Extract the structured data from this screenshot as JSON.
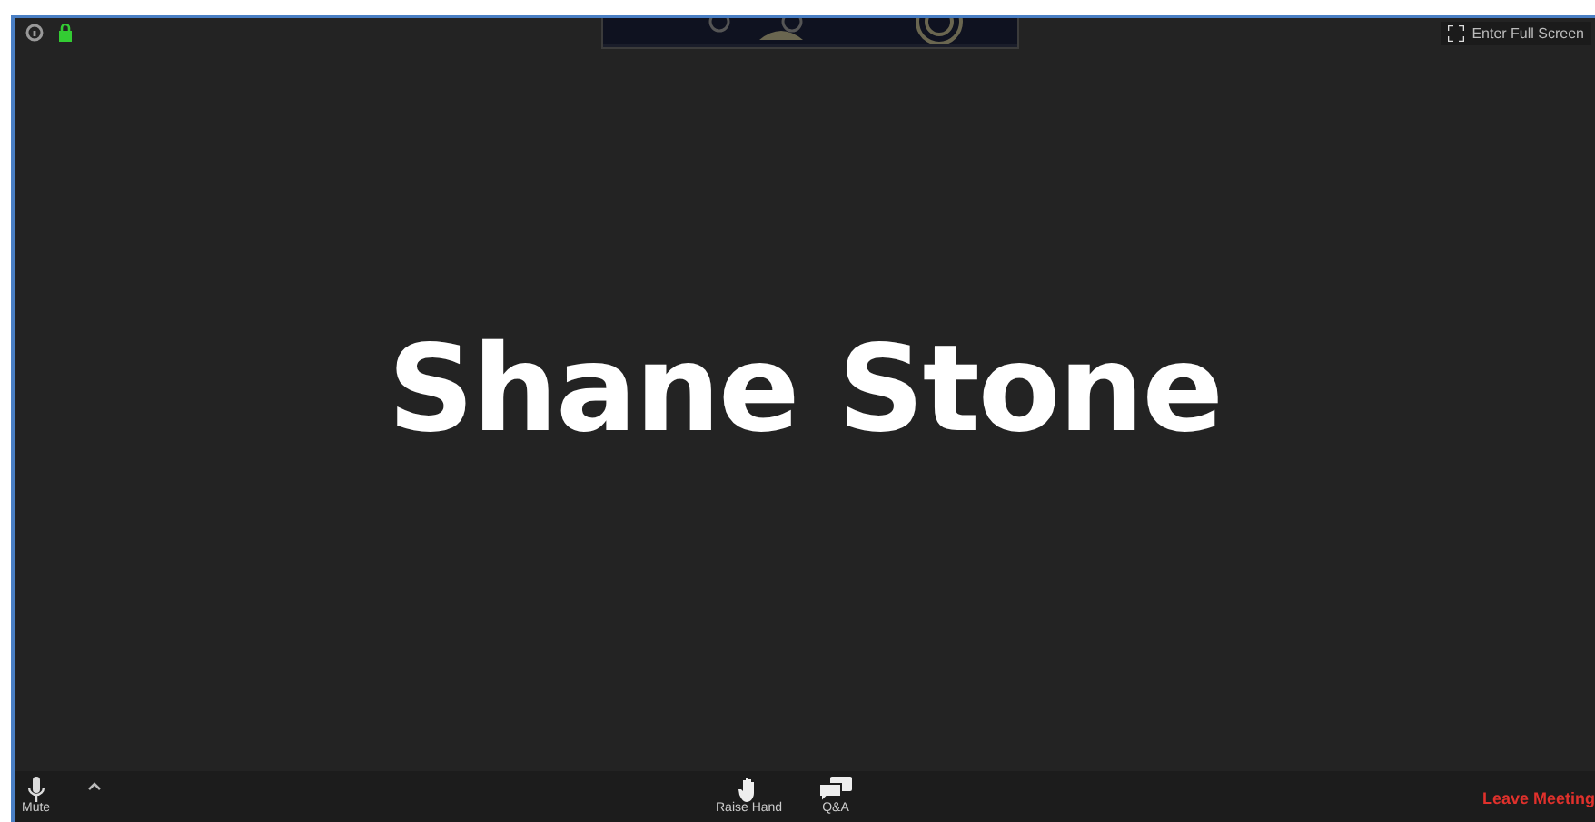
{
  "header": {
    "fullscreen_button": "Enter Full Screen"
  },
  "participant": {
    "name": "Shane Stone"
  },
  "toolbar": {
    "items": [
      {
        "kind": "mute",
        "label": "Mute"
      },
      {
        "kind": "hand",
        "label": "Raise Hand"
      },
      {
        "kind": "qa",
        "label": "Q&A"
      }
    ],
    "leave_button": "Leave Meeting"
  }
}
